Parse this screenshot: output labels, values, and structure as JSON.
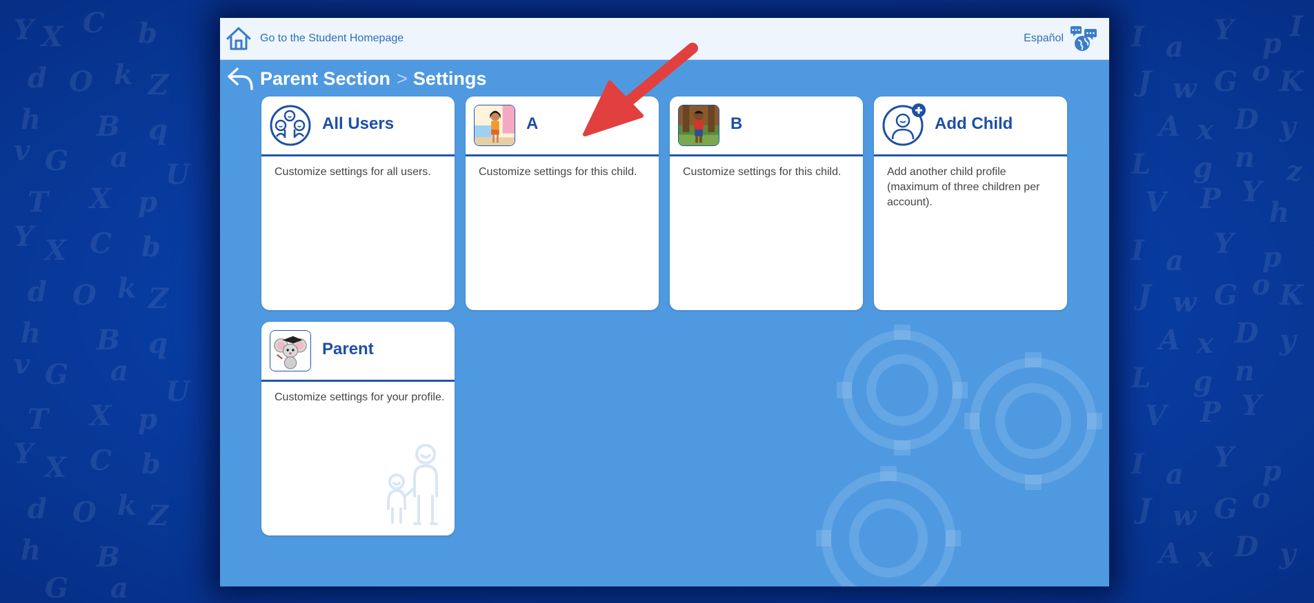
{
  "topbar": {
    "home_label": "Go to the Student Homepage",
    "language_label": "Español"
  },
  "breadcrumb": {
    "section": "Parent Section",
    "separator": ">",
    "current": "Settings"
  },
  "cards": [
    {
      "title": "All Users",
      "description": "Customize settings for all users.",
      "icon": "group-users-icon"
    },
    {
      "title": "A",
      "description": "Customize settings for this child.",
      "icon": "child-avatar-girl"
    },
    {
      "title": "B",
      "description": "Customize settings for this child.",
      "icon": "child-avatar-boy"
    },
    {
      "title": "Add Child",
      "description": "Add another child profile (maximum of three children per account).",
      "icon": "add-child-icon"
    },
    {
      "title": "Parent",
      "description": "Customize settings for your profile.",
      "icon": "mouse-graduate-avatar"
    }
  ],
  "colors": {
    "accent": "#1d4fa5",
    "panel": "#4f99e0",
    "topbar": "#eef5fd",
    "backdrop": "#0a3fa3"
  }
}
